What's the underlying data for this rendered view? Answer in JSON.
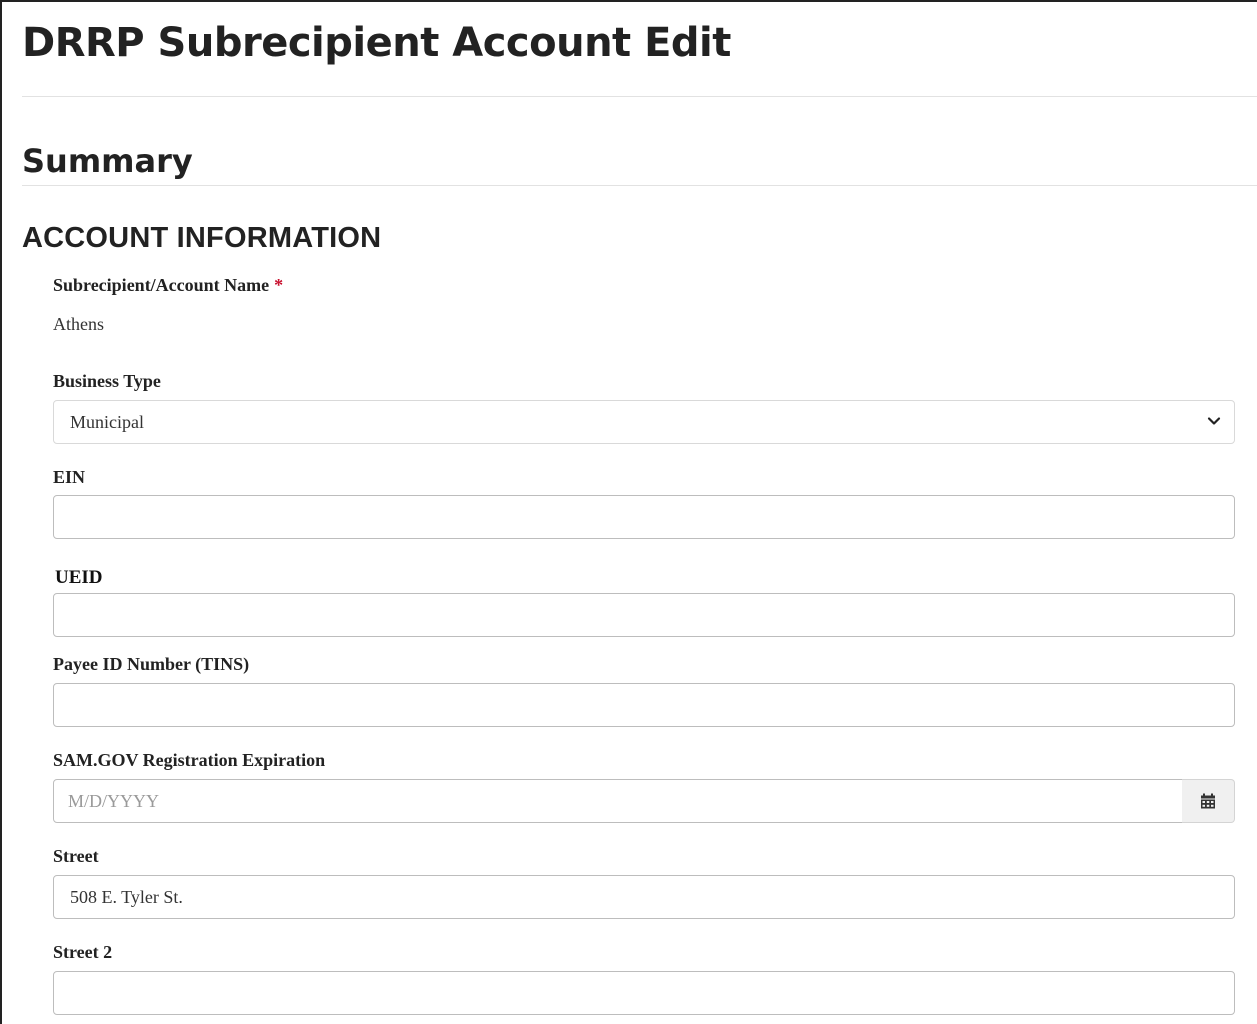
{
  "page": {
    "title": "DRRP Subrecipient Account Edit",
    "section_title": "Summary",
    "subsection_title": "ACCOUNT INFORMATION"
  },
  "form": {
    "account_name": {
      "label": "Subrecipient/Account Name",
      "required_marker": "*",
      "value": "Athens"
    },
    "business_type": {
      "label": "Business Type",
      "selected": "Municipal"
    },
    "ein": {
      "label": "EIN",
      "value": ""
    },
    "ueid": {
      "label": "UEID",
      "value": ""
    },
    "payee_id": {
      "label": "Payee ID Number (TINS)",
      "value": ""
    },
    "sam_expiration": {
      "label": "SAM.GOV Registration Expiration",
      "value": "",
      "placeholder": "M/D/YYYY",
      "button_icon": "calendar-icon"
    },
    "street": {
      "label": "Street",
      "value": "508 E. Tyler St."
    },
    "street2": {
      "label": "Street 2",
      "value": ""
    }
  },
  "colors": {
    "required": "#c8102e",
    "text": "#222222",
    "border": "#bdbdbd"
  }
}
